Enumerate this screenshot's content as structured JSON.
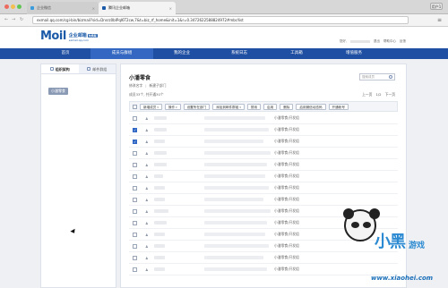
{
  "browser": {
    "tabs": [
      {
        "label": "企业微信"
      },
      {
        "label": "腾讯企业邮箱"
      }
    ],
    "user_chip": "用户1",
    "url": "exmail.qq.com/cgi-bin/bizmail?sid=Dnsrz0bIPqI6T2cw,7&t=biz_rf_home&init=1&r=0.3472622588824972#mbr/list"
  },
  "header": {
    "logo_main": "Moil",
    "logo_cn": "企业邮箱",
    "logo_domain": "exmail.qq.com",
    "logo_badge": "免费版",
    "links": [
      "您好,",
      "退出",
      "帮助中心",
      "反馈"
    ]
  },
  "mainnav": {
    "items": [
      "首页",
      "成员与群组",
      "我的企业",
      "系统日志",
      "工具箱",
      "增值服务"
    ],
    "active_index": 1
  },
  "sidebar": {
    "tabs": [
      "组织架构",
      "邮件群组"
    ],
    "node": "小潘零食"
  },
  "panel": {
    "title": "小潘零食",
    "sub": [
      "修改名字",
      "|",
      "新建子部门"
    ],
    "count": "成员33个, 共开通30个",
    "pagination": [
      "上一页",
      "1/2",
      "下一页"
    ],
    "search_placeholder": "搜索成员",
    "toolbar": [
      {
        "label": "新增成员",
        "dropdown": true
      },
      {
        "label": "操作",
        "dropdown": true
      },
      {
        "label": "设置所在部门",
        "dropdown": false
      },
      {
        "label": "添加到邮件群组",
        "dropdown": true
      },
      {
        "label": "禁用",
        "dropdown": false
      },
      {
        "label": "启用",
        "dropdown": false
      },
      {
        "label": "删除",
        "dropdown": false
      },
      {
        "label": "启用微信动态码",
        "dropdown": false
      },
      {
        "label": "开通帐号",
        "dropdown": false
      }
    ],
    "rows": [
      {
        "checked": false,
        "dept": "小潘零食/开发组"
      },
      {
        "checked": true,
        "dept": "小潘零食/开发组"
      },
      {
        "checked": true,
        "dept": "小潘零食/开发组"
      },
      {
        "checked": false,
        "dept": "小潘零食/开发组"
      },
      {
        "checked": false,
        "dept": "小潘零食/开发组"
      },
      {
        "checked": false,
        "dept": "小潘零食/开发组"
      },
      {
        "checked": false,
        "dept": "小潘零食/开发组"
      },
      {
        "checked": false,
        "dept": "小潘零食/开发组"
      },
      {
        "checked": false,
        "dept": "小潘零食/开发组"
      },
      {
        "checked": false,
        "dept": "小潘零食/开发组"
      },
      {
        "checked": false,
        "dept": "小潘零食/开发组"
      },
      {
        "checked": false,
        "dept": "小潘零食/开发组"
      },
      {
        "checked": false,
        "dept": "小潘零食/开发组"
      },
      {
        "checked": false,
        "dept": "小潘零食/开发组"
      }
    ]
  },
  "watermark": {
    "title": "小黑",
    "subtitle": "游戏",
    "url": "www.xiaohei.com"
  },
  "colors": {
    "nav": "#1f4fa2",
    "nav_active": "#3367c1",
    "brand": "#1b5aa8",
    "checkbox_on": "#2f66c4"
  }
}
